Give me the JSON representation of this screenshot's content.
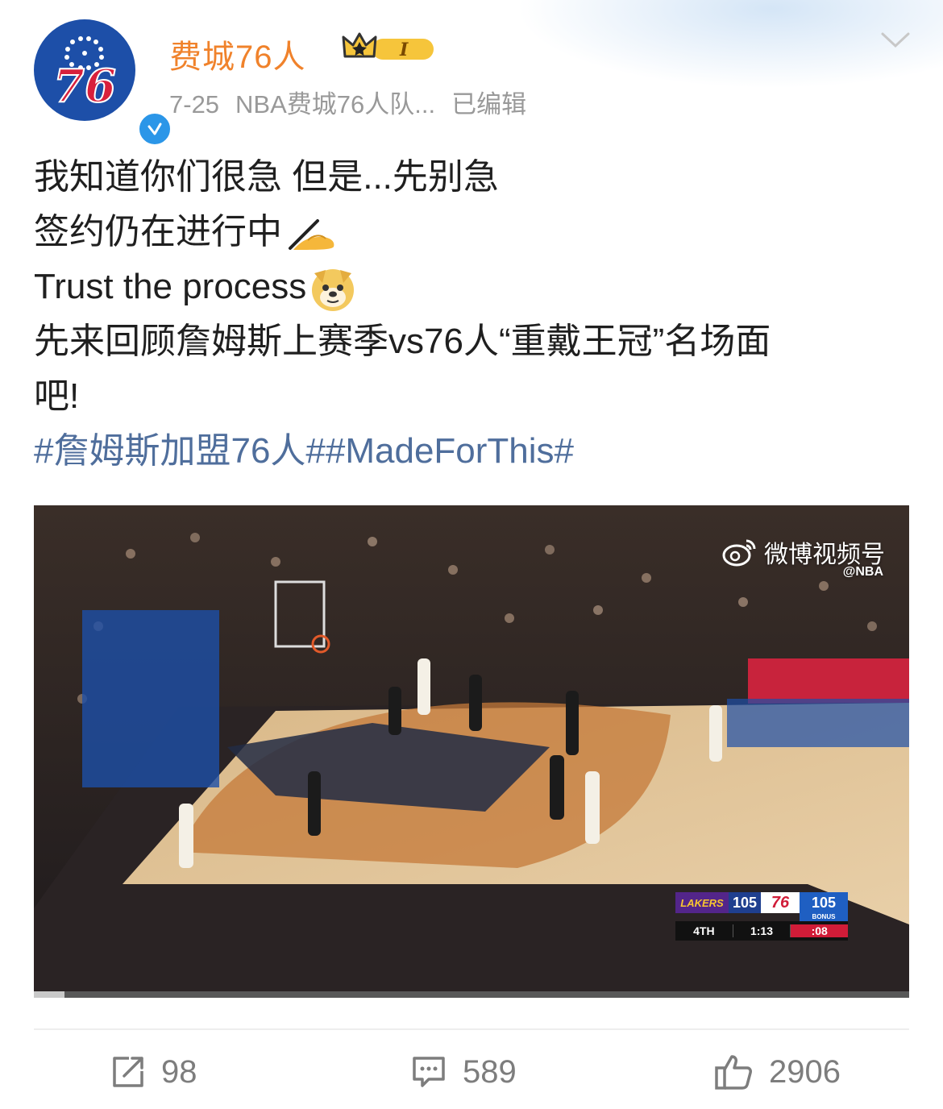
{
  "post": {
    "author": "费城76人",
    "date": "7-25",
    "source": "NBA费城76人队...",
    "edited": "已编辑",
    "lines": [
      "我知道你们很急 但是...先别急",
      "签约仍在进行中",
      "Trust the process",
      "先来回顾詹姆斯上赛季vs76人“重戴王冠”名场面",
      "吧!"
    ],
    "hashtags": "#詹姆斯加盟76人##MadeForThis#"
  },
  "video": {
    "watermark": "微博视频号",
    "watermark_sub": "@NBA",
    "scoreboard": {
      "away_team": "LAKERS",
      "away_score": "105",
      "home_team": "76",
      "home_score": "105",
      "bonus": "BONUS",
      "period": "4TH",
      "clock": "1:13",
      "shot_clock": ":08"
    },
    "progress_fraction": 0.035
  },
  "actions": {
    "repost_count": "98",
    "comment_count": "589",
    "like_count": "2906"
  },
  "colors": {
    "author_name": "#f0822b",
    "hashtag": "#4f6e9c",
    "meta_text": "#999999",
    "verified": "#2b96e8"
  }
}
